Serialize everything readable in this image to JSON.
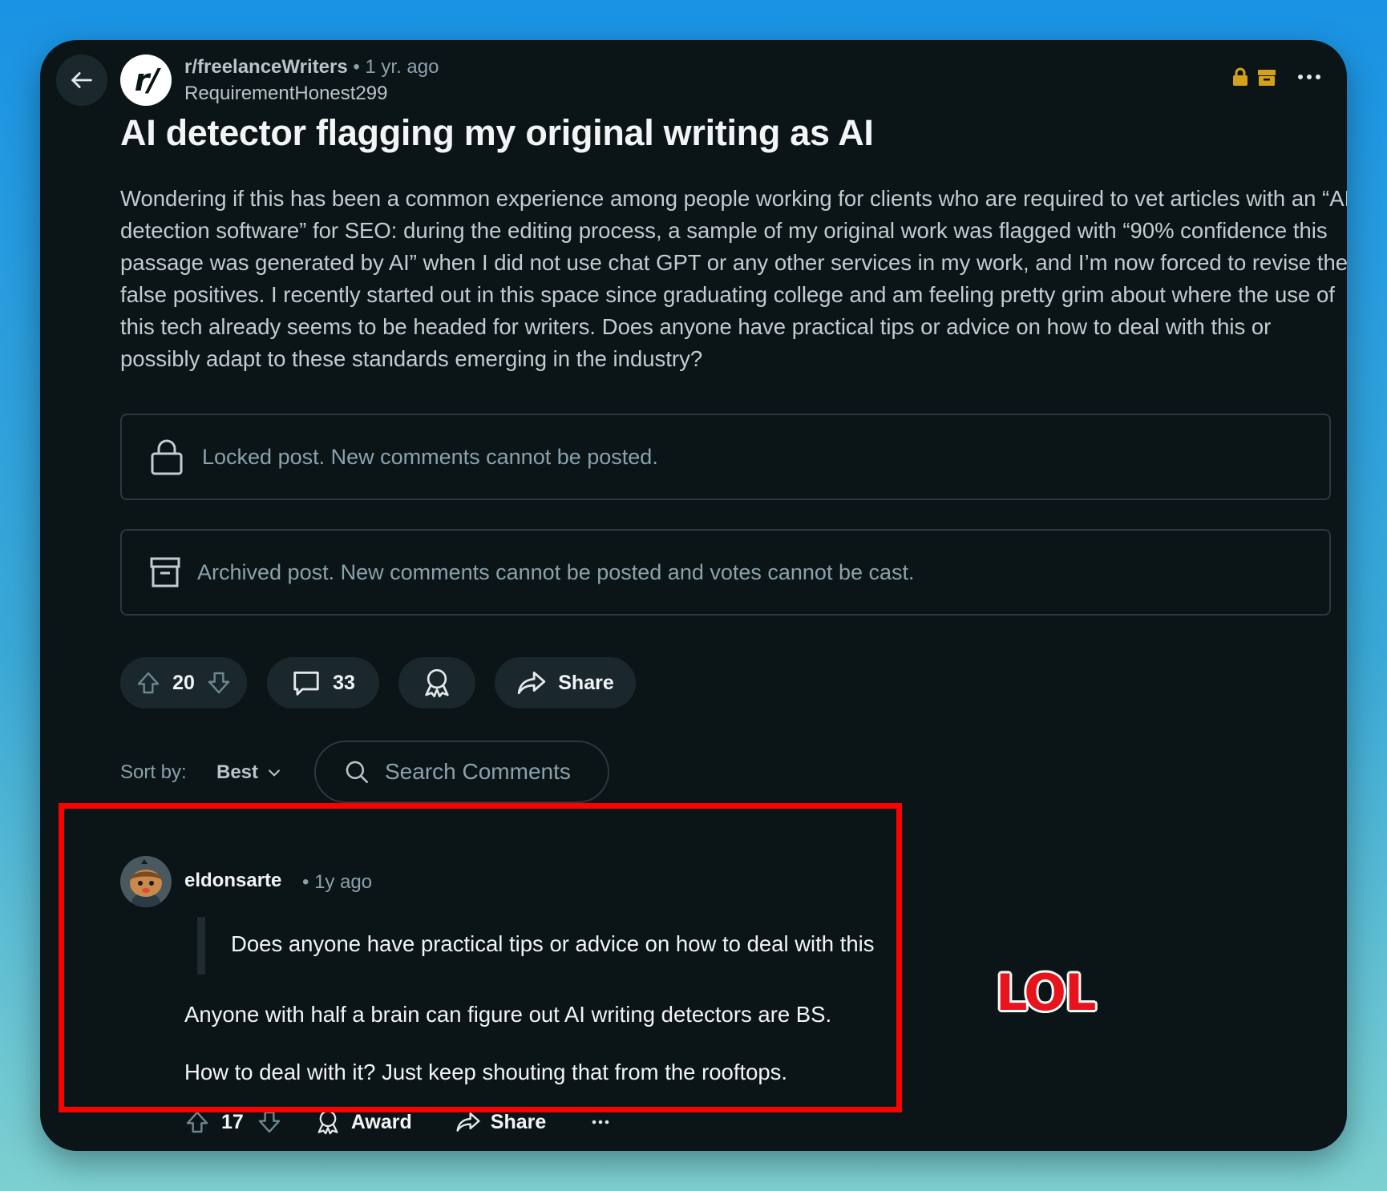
{
  "post": {
    "subreddit": "r/freelanceWriters",
    "subreddit_avatar": "r/",
    "age": "• 1 yr. ago",
    "author": "RequirementHonest299",
    "title": "AI detector flagging my original writing as AI",
    "body": "Wondering if this has been a common experience among people working for clients who are required to vet articles with an “AI detection software” for SEO: during the editing process, a sample of my original work was flagged with “90% confidence this passage was generated by AI” when I did not use chat GPT or any other services in my work, and I’m now forced to revise the false positives. I recently started out in this space since graduating college and am feeling pretty grim about where the use of this tech already seems to be headed for writers. Does anyone have practical tips or advice on how to deal with this or possibly adapt to these standards emerging in the industry?",
    "locked_notice": "Locked post. New comments cannot be posted.",
    "archived_notice": "Archived post. New comments cannot be posted and votes cannot be cast.",
    "votes": "20",
    "comments": "33",
    "share_label": "Share"
  },
  "sort": {
    "label": "Sort by:",
    "value": "Best",
    "search_placeholder": "Search Comments"
  },
  "comment": {
    "username": "eldonsarte",
    "time": "• 1y ago",
    "quote": "Does anyone have practical tips or advice on how to deal with this",
    "paragraph1": "Anyone with half a brain can figure out AI writing detectors are BS.",
    "paragraph2": "How to deal with it? Just keep shouting that from the rooftops.",
    "votes": "17",
    "award_label": "Award",
    "share_label": "Share"
  },
  "annotation": {
    "text": "LOL",
    "color": "#e8141d"
  },
  "colors": {
    "background_top": "#1a93e4",
    "card": "#0b1416",
    "pill": "#1a282d",
    "badge_gold": "#d4a21a",
    "highlight": "#ff0000"
  }
}
